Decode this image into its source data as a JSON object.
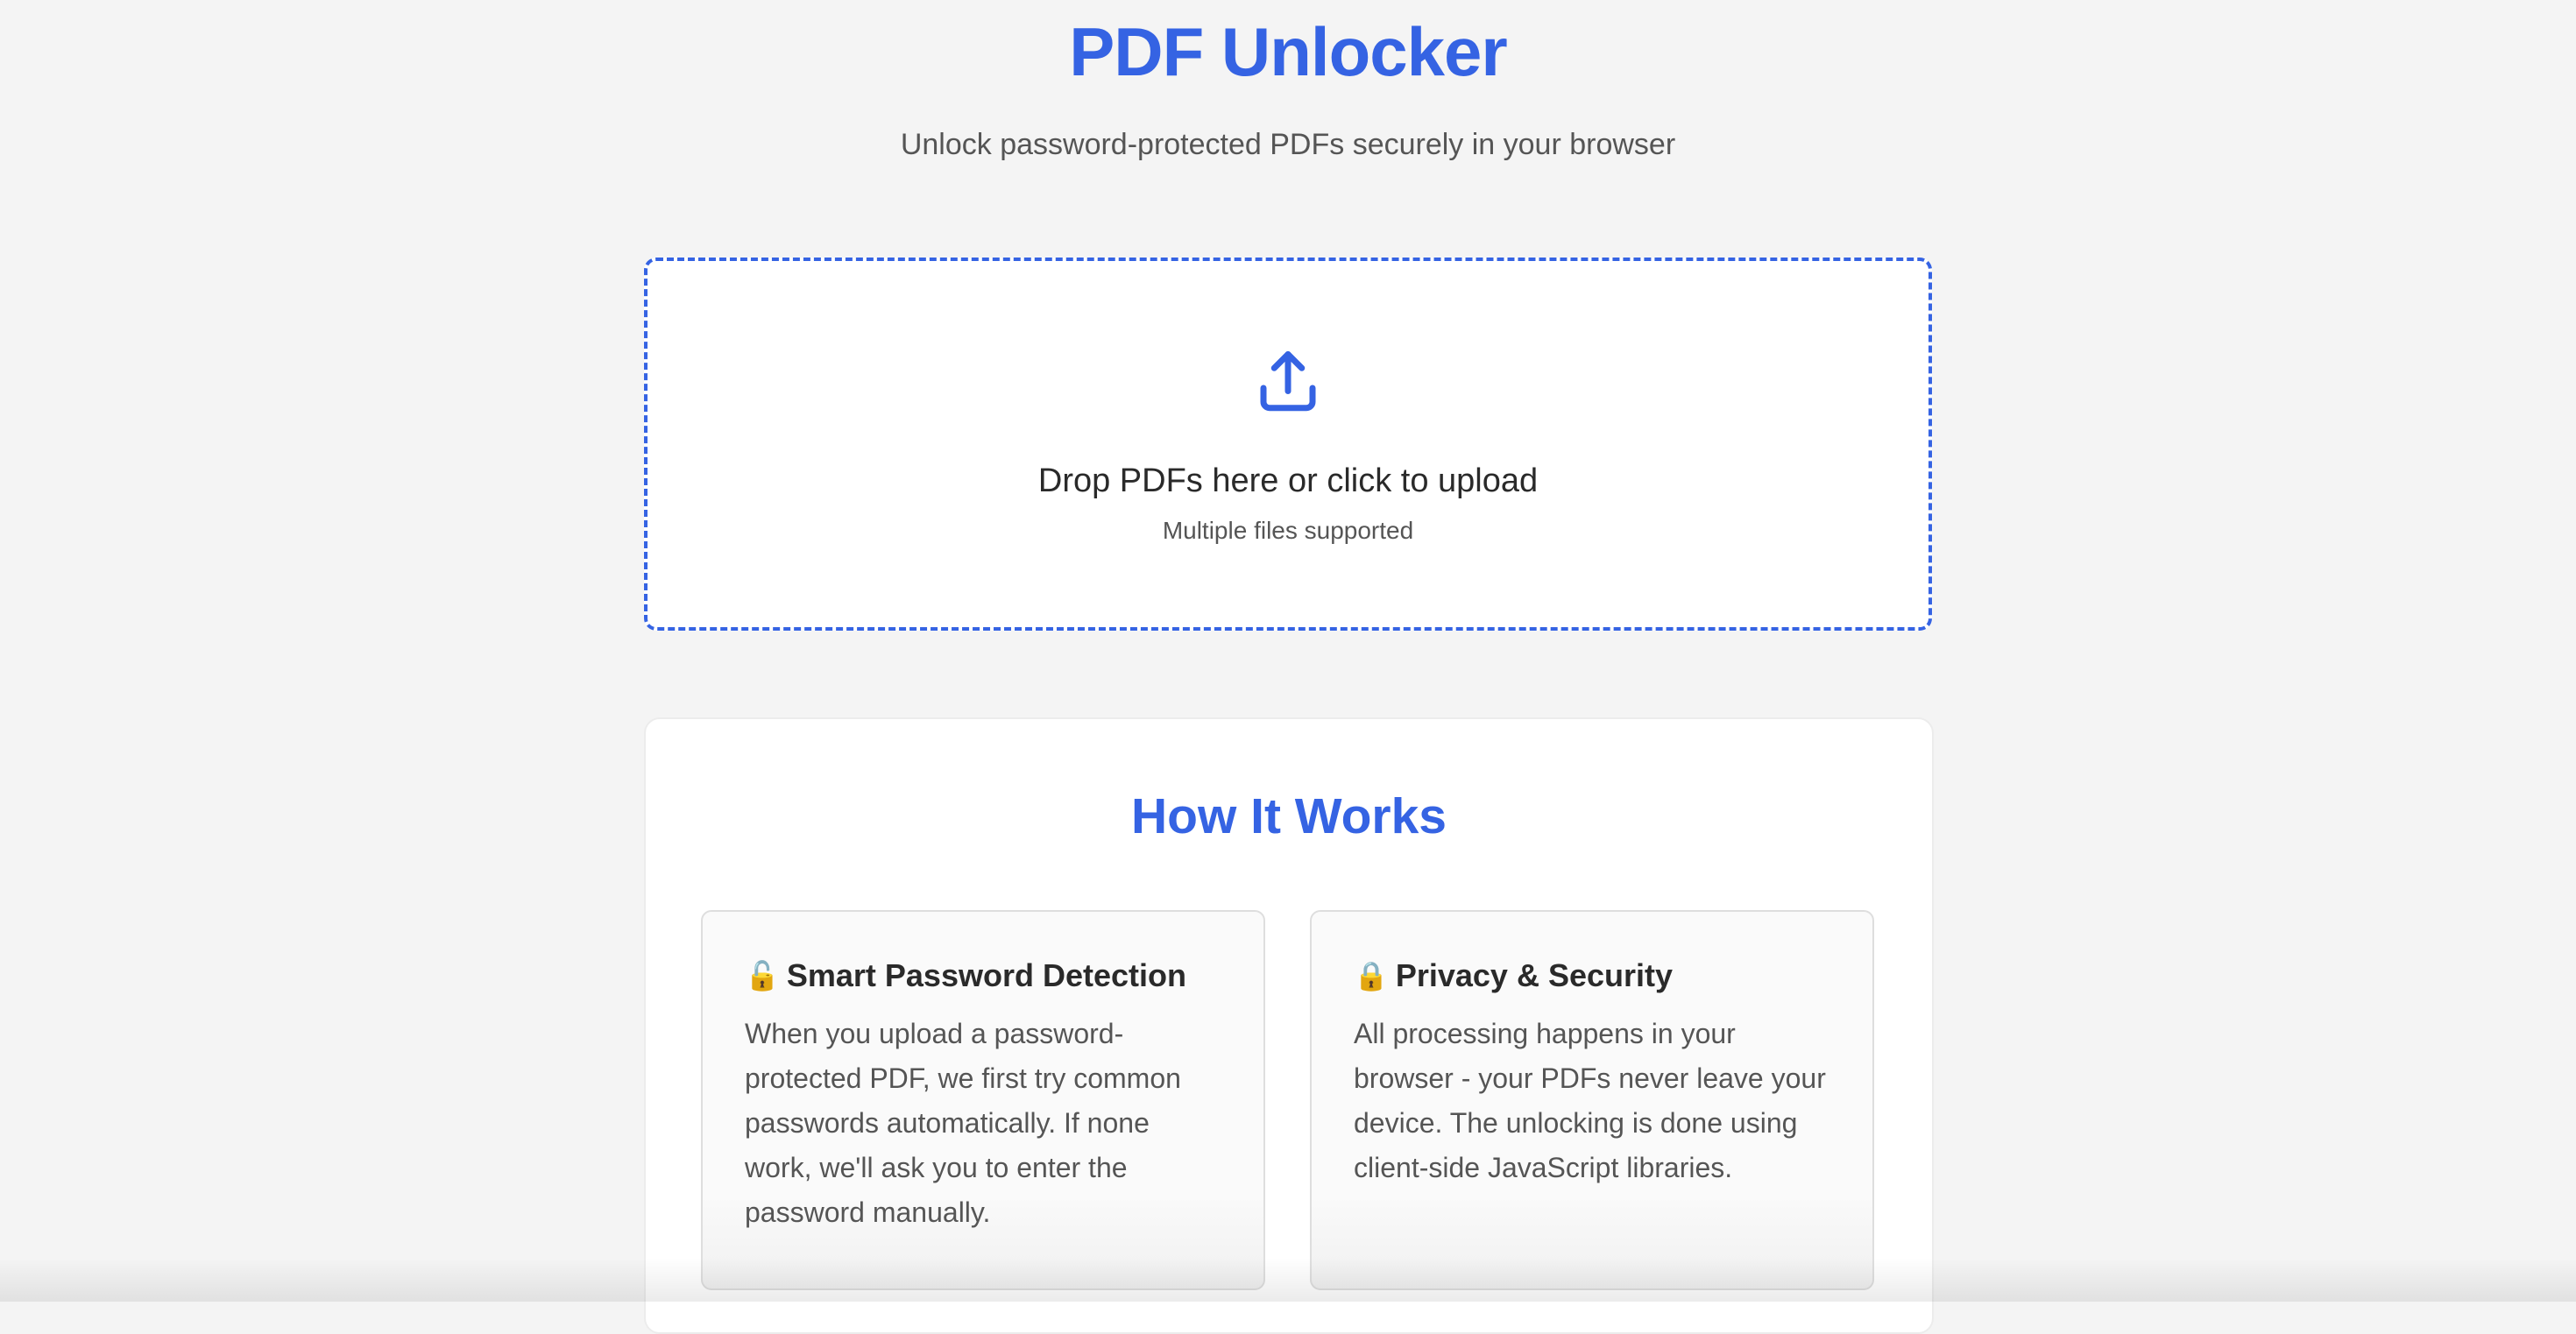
{
  "header": {
    "title": "PDF Unlocker",
    "subtitle": "Unlock password-protected PDFs securely in your browser"
  },
  "dropzone": {
    "icon": "upload-icon",
    "label": "Drop PDFs here or click to upload",
    "hint": "Multiple files supported"
  },
  "how_it_works": {
    "title": "How It Works",
    "cards": [
      {
        "icon": "🔓",
        "title": "Smart Password Detection",
        "body": "When you upload a password-protected PDF, we first try common passwords automatically. If none work, we'll ask you to enter the password manually."
      },
      {
        "icon": "🔒",
        "title": "Privacy & Security",
        "body": "All processing happens in your browser - your PDFs never leave your device. The unlocking is done using client-side JavaScript libraries."
      }
    ]
  },
  "colors": {
    "accent": "#3563e3",
    "background": "#f4f4f4"
  }
}
